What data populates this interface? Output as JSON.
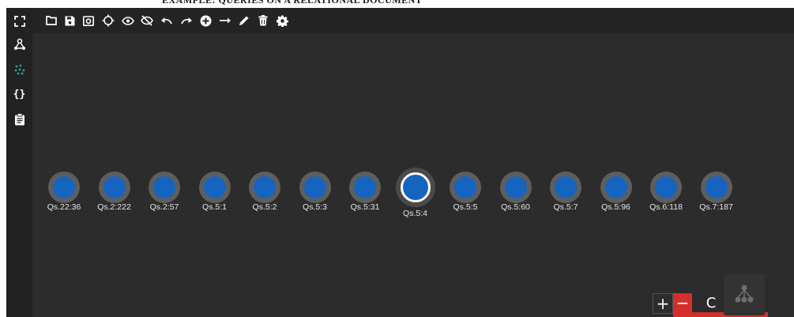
{
  "banner": {
    "text": "EXAMPLE: QUERIES ON A RELATIONAL DOCUMENT"
  },
  "sidebar": {
    "items": [
      {
        "name": "fullscreen-icon"
      },
      {
        "name": "graph-icon"
      },
      {
        "name": "cluster-icon"
      },
      {
        "name": "json-icon"
      },
      {
        "name": "clipboard-icon"
      }
    ]
  },
  "toolbar": {
    "items": [
      {
        "name": "folder-icon"
      },
      {
        "name": "save-icon"
      },
      {
        "name": "camera-icon"
      },
      {
        "name": "crosshair-icon"
      },
      {
        "name": "eye-icon"
      },
      {
        "name": "eye-off-icon"
      },
      {
        "name": "undo-icon"
      },
      {
        "name": "redo-icon"
      },
      {
        "name": "add-node-icon"
      },
      {
        "name": "add-edge-icon"
      },
      {
        "name": "edit-icon"
      },
      {
        "name": "delete-icon"
      },
      {
        "name": "settings-icon"
      }
    ]
  },
  "graph": {
    "nodes": [
      {
        "label": "Qs.22:36"
      },
      {
        "label": "Qs.2:222"
      },
      {
        "label": "Qs.2:57"
      },
      {
        "label": "Qs.5:1"
      },
      {
        "label": "Qs.5:2"
      },
      {
        "label": "Qs.5:3"
      },
      {
        "label": "Qs.5:31"
      },
      {
        "label": "Qs.5:4",
        "selected": true
      },
      {
        "label": "Qs.5:5"
      },
      {
        "label": "Qs.5:60"
      },
      {
        "label": "Qs.5:7"
      },
      {
        "label": "Qs.5:96"
      },
      {
        "label": "Qs.6:118"
      },
      {
        "label": "Qs.7:187"
      }
    ]
  },
  "zoom": {
    "plus": "+",
    "minus": "−",
    "reset": "C"
  },
  "colors": {
    "node": "#1565c0",
    "halo": "#5e5e5e",
    "accent": "#26a69a",
    "danger": "#d32f2f"
  }
}
